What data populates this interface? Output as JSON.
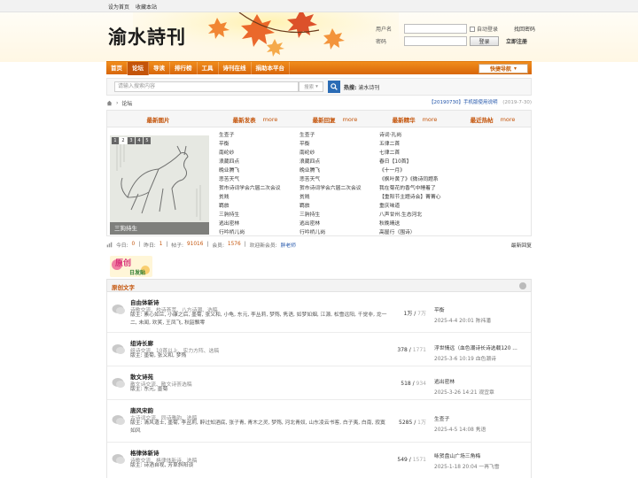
{
  "topbar": {
    "set_home": "设为首页",
    "bookmark": "收藏本站"
  },
  "header": {
    "logo": "渝水詩刊",
    "username_label": "用户名",
    "password_label": "密码",
    "auto_login": "自动登录",
    "forgot_password": "找回密码",
    "login_button": "登录",
    "register": "立即注册"
  },
  "nav": {
    "items": [
      "首页",
      "论坛",
      "导读",
      "排行榜",
      "工具",
      "诗刊在线",
      "捐助本平台"
    ],
    "active_index": 1,
    "quick_nav": "快捷导航"
  },
  "search": {
    "placeholder": "请输入搜索内容",
    "type": "搜索",
    "hot_label": "热搜:",
    "hot_term": "渝水诗刊"
  },
  "breadcrumb": {
    "current": "论坛"
  },
  "notice": {
    "title": "【20190730】手机版使用说明",
    "date": "(2019-7-30)"
  },
  "portal": {
    "tabs": [
      {
        "title": "最新图片",
        "more": ""
      },
      {
        "title": "最新发表",
        "more": "more"
      },
      {
        "title": "最新回复",
        "more": "more"
      },
      {
        "title": "最新精华",
        "more": "more"
      },
      {
        "title": "最近热帖",
        "more": "more"
      }
    ],
    "slide": {
      "pages": [
        "1",
        "2",
        "3",
        "4",
        "5"
      ],
      "current_page": 2,
      "caption": "三狗持生"
    },
    "list_new": [
      "生查子",
      "平衡",
      "南纶纱",
      "浪葳四点",
      "晚业腾飞",
      "悲苦天气",
      "贺市诗词学会六届二次会议",
      "贫贱",
      "羁旅",
      "三驹持生",
      "逃出密林",
      "行吟桥儿岗"
    ],
    "list_reply": [
      "生查子",
      "平衡",
      "南纶纱",
      "浪葳四点",
      "晚业腾飞",
      "悲苦天气",
      "贺市诗词学会六届二次会议",
      "贫贱",
      "羁旅",
      "三驹持生",
      "逃出密林",
      "行吟桥儿岗"
    ],
    "list_digest": [
      "诗词·孔岗",
      "五律二首",
      "七律二首",
      "春日【10首】",
      "《十一月》",
      "《枫叶黄了》《微诗同题系",
      "我在菊花的香气中睡着了",
      "【重阳节主题诗会】菁菁心",
      "重庆味道",
      "八声甘州.生态河北",
      "秋晚晴送",
      "高屋行（围诗）"
    ]
  },
  "stats": {
    "today_label": "今日:",
    "today": "0",
    "yesterday_label": "昨日:",
    "yesterday": "1",
    "posts_label": "帖子:",
    "posts": "91016",
    "members_label": "会员:",
    "members": "1576",
    "welcome_label": "欢迎新会员:",
    "new_member": "胖老师",
    "newest_reply": "最新回复"
  },
  "forum_banner": {
    "title": "原创",
    "subtitle": "日发贴"
  },
  "category": {
    "title": "原创文字"
  },
  "forums": [
    {
      "name": "自由体新诗",
      "desc": "诗歌交流、校诗荟萃、八方诗潮、选稿",
      "mods": "版主: 素心如兰, 小康之后, 墨菊, 张义和, 小龟, 东元, 李丛莉, 梦殇, 隽语, 如梦如烟, 江源, 松雪远阳, 千觉非, 龙一二, 未闻, 欢笑, 王凤飞, 秋韶飘零",
      "threads": "1万",
      "posts": "7万",
      "last_title": "平衡",
      "last_meta": "2025-4-4 20:01 陈祎潘"
    },
    {
      "name": "组诗长廊",
      "desc": "组诗交流、10首以上、实力方阵、选稿",
      "mods": "版主: 墨菊, 张义和, 梦殇",
      "threads": "378",
      "posts": "1771",
      "last_title": "浮世情远（血色潮诗长诗选载120 ...",
      "last_meta": "2025-3-6 10:19 血色潮诗"
    },
    {
      "name": "散文诗苑",
      "desc": "散文诗交流、散文诗荟选稿",
      "mods": "版主: 东元, 墨菊",
      "threads": "518",
      "posts": "934",
      "last_title": "逃出密林",
      "last_meta": "2025-3-26 14:21 观宜章"
    },
    {
      "name": "唐风宋韵",
      "desc": "古诗词交流、同诗雅韵、选稿",
      "mods": "版主: 清风道士, 墨菊, 李丛莉, 醉过知酒底, 张子青, 青木之灵, 梦殇, 河北青奴, 山东凌云书客, 白子夷, 白南, 寂寞如风",
      "threads": "5285",
      "posts": "1万",
      "last_title": "生查子",
      "last_meta": "2025-4-5 14:08 隽语"
    },
    {
      "name": "格律体新诗",
      "desc": "诗歌交流、格律体新诗、选稿",
      "mods": "版主: 诗酒自视, 芳草斜阳谈",
      "threads": "549",
      "posts": "1571",
      "last_title": "咏贺盘山广场三角梅",
      "last_meta": "2025-1-18 20:04 一再飞雪"
    }
  ],
  "colors": {
    "accent": "#e3741a",
    "nav": "#d8660a",
    "link": "#2255aa"
  }
}
